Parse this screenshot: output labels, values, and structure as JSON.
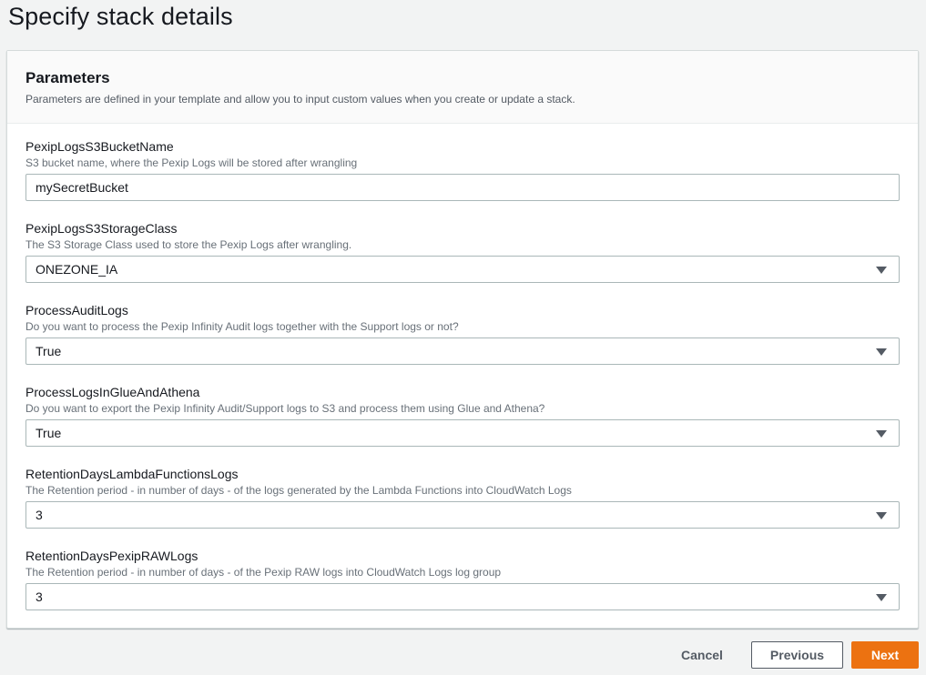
{
  "page_title": "Specify stack details",
  "parameters": {
    "title": "Parameters",
    "description": "Parameters are defined in your template and allow you to input custom values when you create or update a stack.",
    "fields": [
      {
        "name": "PexipLogsS3BucketName",
        "description": "S3 bucket name, where the Pexip Logs will be stored after wrangling",
        "value": "mySecretBucket",
        "kind": "text"
      },
      {
        "name": "PexipLogsS3StorageClass",
        "description": "The S3 Storage Class used to store the Pexip Logs after wrangling.",
        "value": "ONEZONE_IA",
        "kind": "select"
      },
      {
        "name": "ProcessAuditLogs",
        "description": "Do you want to process the Pexip Infinity Audit logs together with the Support logs or not?",
        "value": "True",
        "kind": "select"
      },
      {
        "name": "ProcessLogsInGlueAndAthena",
        "description": "Do you want to export the Pexip Infinity Audit/Support logs to S3 and process them using Glue and Athena?",
        "value": "True",
        "kind": "select"
      },
      {
        "name": "RetentionDaysLambdaFunctionsLogs",
        "description": "The Retention period - in number of days - of the logs generated by the Lambda Functions into CloudWatch Logs",
        "value": "3",
        "kind": "select"
      },
      {
        "name": "RetentionDaysPexipRAWLogs",
        "description": "The Retention period - in number of days - of the Pexip RAW logs into CloudWatch Logs log group",
        "value": "3",
        "kind": "select"
      }
    ]
  },
  "footer": {
    "cancel_label": "Cancel",
    "previous_label": "Previous",
    "next_label": "Next"
  },
  "icons": {
    "dropdown": "caret-down-icon"
  },
  "colors": {
    "primary_button": "#ec7211",
    "background": "#f2f3f3"
  }
}
